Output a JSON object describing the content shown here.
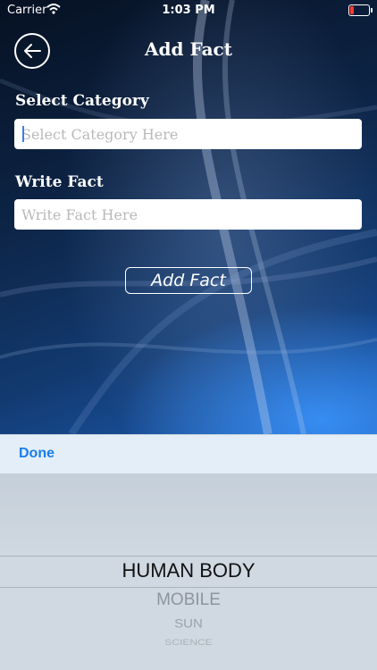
{
  "status_bar": {
    "carrier": "Carrier",
    "time": "1:03 PM"
  },
  "header": {
    "title": "Add Fact",
    "back_icon": "arrow-left-icon"
  },
  "form": {
    "category_label": "Select Category",
    "category_placeholder": "Select Category Here",
    "fact_label": "Write Fact",
    "fact_placeholder": "Write Fact Here",
    "submit_label": "Add Fact"
  },
  "picker": {
    "done_label": "Done",
    "selected": "HUMAN BODY",
    "rows_below": [
      "MOBILE",
      "SUN",
      "SCIENCE"
    ]
  },
  "colors": {
    "accent": "#1a7ee8",
    "toolbar": "#e3eef9",
    "picker": "#d0d9e2",
    "battery_low": "#ff3b30"
  }
}
